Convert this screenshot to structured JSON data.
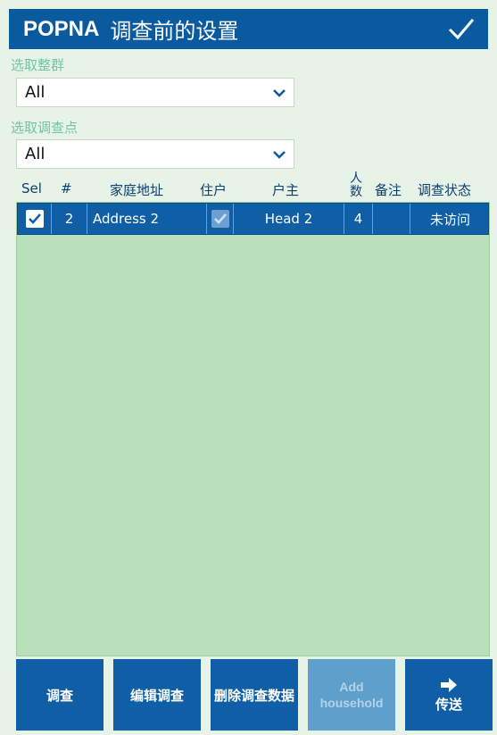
{
  "header": {
    "app": "POPNA",
    "title": "调查前的设置",
    "confirm_icon": "check-icon"
  },
  "filters": {
    "cluster_label": "选取整群",
    "cluster_value": "All",
    "point_label": "选取调查点",
    "point_value": "All"
  },
  "table": {
    "columns": [
      "Sel",
      "#",
      "家庭地址",
      "住户",
      "户主",
      "人数",
      "备注",
      "调查状态"
    ],
    "rows": [
      {
        "selected": true,
        "number": "2",
        "address": "Address 2",
        "resident": true,
        "head": "Head 2",
        "count": "4",
        "note": "",
        "status": "未访问"
      }
    ]
  },
  "buttons": {
    "survey": "调查",
    "edit": "编辑调查",
    "delete": "删除调查数据",
    "add": "Add household",
    "send": "传送"
  },
  "colors": {
    "primary": "#0a5aa0",
    "table_bg": "#b8e1bb",
    "label": "#6fc4a6"
  }
}
